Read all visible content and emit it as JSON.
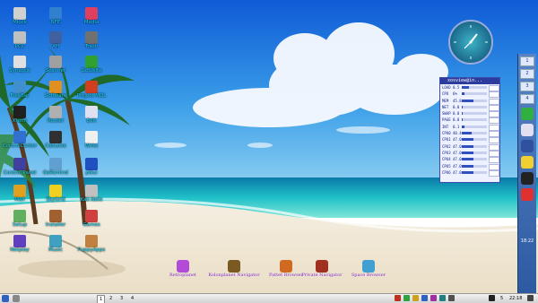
{
  "desktop_icons": [
    {
      "label": "Mlock",
      "icon": "lock-icon"
    },
    {
      "label": "NFE",
      "icon": "network-icon"
    },
    {
      "label": "Media",
      "icon": "media-icon"
    },
    {
      "label": "PCC",
      "icon": "control-center-icon"
    },
    {
      "label": "XH",
      "icon": "folder-icon"
    },
    {
      "label": "Trash",
      "icon": "trash-icon"
    },
    {
      "label": "Synaptic",
      "icon": "package-icon"
    },
    {
      "label": "Scanner",
      "icon": "scanner-icon"
    },
    {
      "label": "GoSIkite",
      "icon": "paint-icon"
    },
    {
      "label": "FreeBar",
      "icon": "bar-icon"
    },
    {
      "label": "Software",
      "icon": "software-icon"
    },
    {
      "label": "Project MDL",
      "icon": "project-icon"
    },
    {
      "label": "Xterm",
      "icon": "terminal-icon"
    },
    {
      "label": "Router",
      "icon": "router-icon"
    },
    {
      "label": "Edit",
      "icon": "editor-icon"
    },
    {
      "label": "ControlCenter",
      "icon": "settings-icon"
    },
    {
      "label": "Calcurse",
      "icon": "calendar-icon"
    },
    {
      "label": "Write",
      "icon": "write-icon"
    },
    {
      "label": "Control Panel",
      "icon": "control-panel-icon"
    },
    {
      "label": "GsRemind",
      "icon": "reminder-icon"
    },
    {
      "label": "pGui",
      "icon": "player-icon"
    },
    {
      "label": "Mail",
      "icon": "mail-icon"
    },
    {
      "label": "SkyGrid",
      "icon": "smiley-icon"
    },
    {
      "label": "Kali Note",
      "icon": "note-icon"
    },
    {
      "label": "Setup",
      "icon": "setup-icon"
    },
    {
      "label": "Installer",
      "icon": "installer-icon"
    },
    {
      "label": "Games",
      "icon": "games-icon"
    },
    {
      "label": "Netplay",
      "icon": "netplay-icon"
    },
    {
      "label": "Music",
      "icon": "music-icon"
    },
    {
      "label": "PuppyApps",
      "icon": "puppy-icon"
    }
  ],
  "bottom_icons": [
    {
      "label": "Retroplanet",
      "icon": "retro-icon",
      "color": "#b34bd8"
    },
    {
      "label": "Kolonplanet Navigator",
      "icon": "helm-icon",
      "color": "#7a5a20"
    },
    {
      "label": "Pattet Browser",
      "icon": "browser-icon",
      "color": "#d06a20"
    },
    {
      "label": "Private Navigator",
      "icon": "navigator-icon",
      "color": "#a03020"
    },
    {
      "label": "Space Browser",
      "icon": "space-icon",
      "color": "#40a0d0"
    }
  ],
  "monitor": {
    "title": "xosview@in...",
    "rows": [
      {
        "label": "LOAD",
        "value": "0.5",
        "fill": 0.3
      },
      {
        "label": "CPU",
        "value": "6%",
        "fill": 0.1
      },
      {
        "label": "MEM",
        "value": "45.8",
        "fill": 0.45
      },
      {
        "label": "NET",
        "value": "0.0",
        "fill": 0.05
      },
      {
        "label": "SWAP",
        "value": "0.0",
        "fill": 0.02
      },
      {
        "label": "PAGE",
        "value": "0.0",
        "fill": 0.02
      },
      {
        "label": "INT",
        "value": "0.1",
        "fill": 0.1
      },
      {
        "label": "CPU0",
        "value": "40.4",
        "fill": 0.4
      },
      {
        "label": "CPU1",
        "value": "47.0",
        "fill": 0.47
      },
      {
        "label": "CPU2",
        "value": "47.0",
        "fill": 0.47
      },
      {
        "label": "CPU3",
        "value": "47.0",
        "fill": 0.47
      },
      {
        "label": "CPU4",
        "value": "47.0",
        "fill": 0.47
      },
      {
        "label": "CPU5",
        "value": "47.0",
        "fill": 0.47
      },
      {
        "label": "CPU6",
        "value": "47.0",
        "fill": 0.47
      }
    ]
  },
  "dock": {
    "items": [
      {
        "name": "workspace-1",
        "label": "1"
      },
      {
        "name": "workspace-2",
        "label": "2"
      },
      {
        "name": "workspace-3",
        "label": "3"
      },
      {
        "name": "workspace-4",
        "label": "4"
      }
    ],
    "apps": [
      "puzzle-icon",
      "disc-icon",
      "window-icon",
      "smiley-icon",
      "penguin-icon",
      "vivaldi-icon"
    ],
    "time": "18:22"
  },
  "taskbar": {
    "workspaces": [
      "1",
      "2",
      "3",
      "4"
    ],
    "time": "22:18",
    "right_text": "5"
  },
  "colors": {
    "accent": "#1fe0ff",
    "taskbar": "#e4e4e4",
    "dock": "#3a6ab4"
  }
}
